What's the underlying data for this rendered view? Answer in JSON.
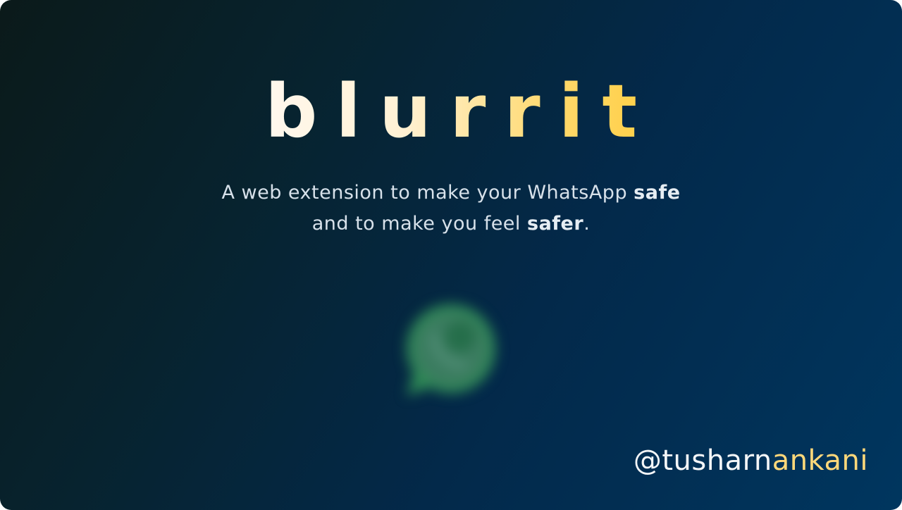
{
  "brand": {
    "name": "blurrit"
  },
  "tagline": {
    "line1_pre": "A web extension to make your WhatsApp ",
    "line1_bold": "safe",
    "line2_pre": "and to make you feel ",
    "line2_bold": "safer",
    "line2_post": "."
  },
  "logo": {
    "icon": "whatsapp-logo-icon",
    "blurred": true,
    "color": "#25a14a"
  },
  "handle": {
    "prefix": "@tusharn",
    "accent": "ankani"
  },
  "colors": {
    "background_start": "#0b1a1a",
    "background_end": "#00365f",
    "title_start": "#fff8ee",
    "title_end": "#ffcf45",
    "handle_accent": "#ffd87a"
  }
}
